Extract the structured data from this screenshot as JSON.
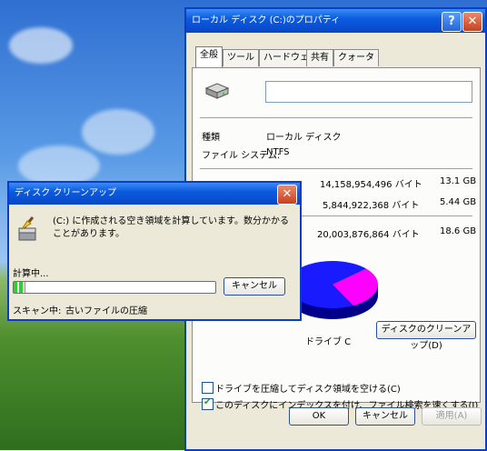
{
  "props": {
    "title": "ローカル ディスク (C:)のプロパティ",
    "tabs": [
      "全般",
      "ツール",
      "ハードウェア",
      "共有",
      "クォータ"
    ],
    "name_value": "",
    "type_label": "種類",
    "type_value": "ローカル ディスク",
    "fs_label": "ファイル システム:",
    "fs_value": "NTFS",
    "used_bytes": "14,158,954,496 バイト",
    "used_gb": "13.1 GB",
    "free_bytes": "5,844,922,368 バイト",
    "free_gb": "5.44 GB",
    "cap_bytes": "20,003,876,864 バイト",
    "cap_gb": "18.6 GB",
    "drive_label": "ドライブ C",
    "cleanup_button": "ディスクのクリーンアップ(D)",
    "compress_label": "ドライブを圧縮してディスク領域を空ける(C)",
    "index_label": "このディスクにインデックスを付け、ファイル検索を速くする(I)",
    "ok": "OK",
    "cancel": "キャンセル",
    "apply": "適用(A)",
    "used_fraction": 0.708,
    "used_color": "#1a1aff",
    "free_color": "#ff00ff"
  },
  "cleanup": {
    "title": "ディスク クリーンアップ",
    "message": "(C:) に作成される空き領域を計算しています。数分かかることがあります。",
    "calc_label": "計算中...",
    "cancel": "キャンセル",
    "scan_label": "スキャン中:",
    "scan_value": "古いファイルの圧縮",
    "progress": 0.06
  }
}
